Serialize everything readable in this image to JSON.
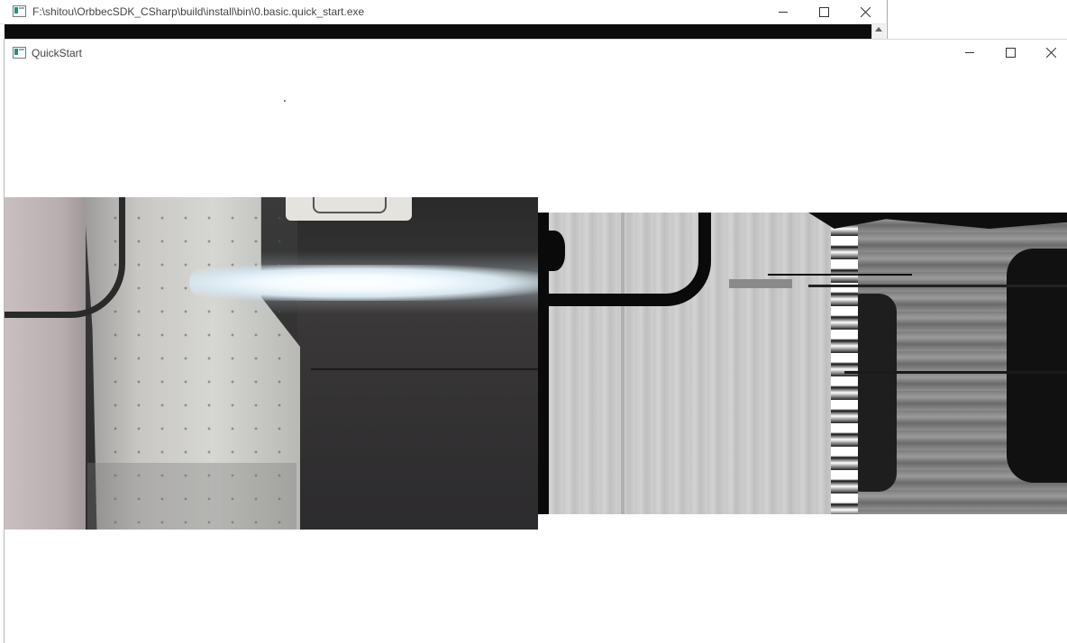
{
  "console_window": {
    "title": "F:\\shitou\\OrbbecSDK_CSharp\\build\\install\\bin\\0.basic.quick_start.exe",
    "app_icon": "app-window-icon",
    "controls": [
      "minimize-icon",
      "maximize-icon",
      "close-icon"
    ]
  },
  "quickstart_window": {
    "title": "QuickStart",
    "app_icon": "app-window-icon",
    "controls": [
      "minimize-icon",
      "maximize-icon",
      "close-icon"
    ],
    "views": [
      {
        "name": "color-stream-view",
        "kind": "color camera image"
      },
      {
        "name": "depth-stream-view",
        "kind": "grayscale depth map"
      }
    ]
  },
  "colors": {
    "titlebar_bg": "#ffffff",
    "title_text": "#444444",
    "console_body": "#0c0c0c",
    "client_bg": "#ffffff"
  }
}
